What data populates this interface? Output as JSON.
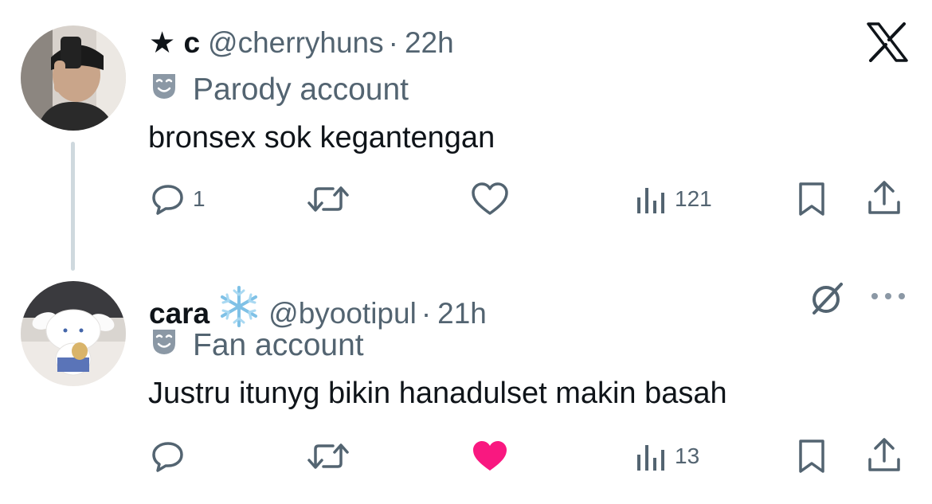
{
  "tweets": [
    {
      "name": "★ c",
      "handle": "@cherryhuns",
      "time": "22h",
      "account_label": "Parody account",
      "text": "bronsex sok kegantengan",
      "replies": "1",
      "retweets": "",
      "likes": "",
      "views": "121",
      "liked": false
    },
    {
      "name": "cara",
      "name_emoji": "snowflake-icon",
      "handle": "@byootipul",
      "time": "21h",
      "account_label": "Fan account",
      "text": "Justru itunyg bikin hanadulset makin basah",
      "replies": "",
      "retweets": "",
      "likes": "",
      "views": "13",
      "liked": true
    }
  ],
  "colors": {
    "text": "#0f1419",
    "secondary": "#536471",
    "like_active": "#f91880",
    "thread_line": "#cfd9de"
  },
  "icons": [
    "x-logo-icon",
    "theater-mask-icon",
    "reply-icon",
    "retweet-icon",
    "heart-icon",
    "views-icon",
    "bookmark-icon",
    "share-icon",
    "grok-icon",
    "more-icon"
  ]
}
